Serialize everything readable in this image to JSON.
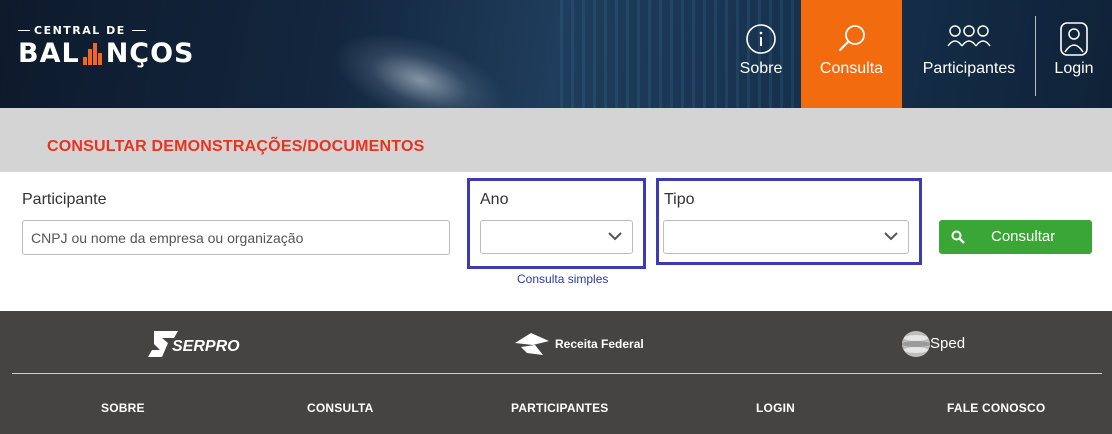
{
  "header": {
    "logo": {
      "top_text": "CENTRAL DE",
      "main_text_a": "BAL",
      "main_text_b": "NÇOS"
    },
    "nav": [
      {
        "label": "Sobre",
        "icon": "info-icon"
      },
      {
        "label": "Consulta",
        "icon": "search-icon",
        "active": true
      },
      {
        "label": "Participantes",
        "icon": "people-icon"
      },
      {
        "label": "Login",
        "icon": "user-icon"
      }
    ]
  },
  "band": {
    "title": "CONSULTAR DEMONSTRAÇÕES/DOCUMENTOS"
  },
  "form": {
    "participante": {
      "label": "Participante",
      "placeholder": "CNPJ ou nome da empresa ou organização",
      "value": ""
    },
    "ano": {
      "label": "Ano",
      "selected": ""
    },
    "tipo": {
      "label": "Tipo",
      "selected": ""
    },
    "consulta_simples": "Consulta simples",
    "submit_label": "Consultar"
  },
  "footer": {
    "logos": [
      "SERPRO",
      "Receita Federal",
      "Sped"
    ],
    "links": [
      "SOBRE",
      "CONSULTA",
      "PARTICIPANTES",
      "LOGIN",
      "FALE CONOSCO"
    ]
  },
  "colors": {
    "accent_orange": "#f26b0f",
    "title_red": "#e8331e",
    "button_green": "#3aa635",
    "highlight_blue": "#3b3bb3",
    "footer_bg": "#464343"
  }
}
